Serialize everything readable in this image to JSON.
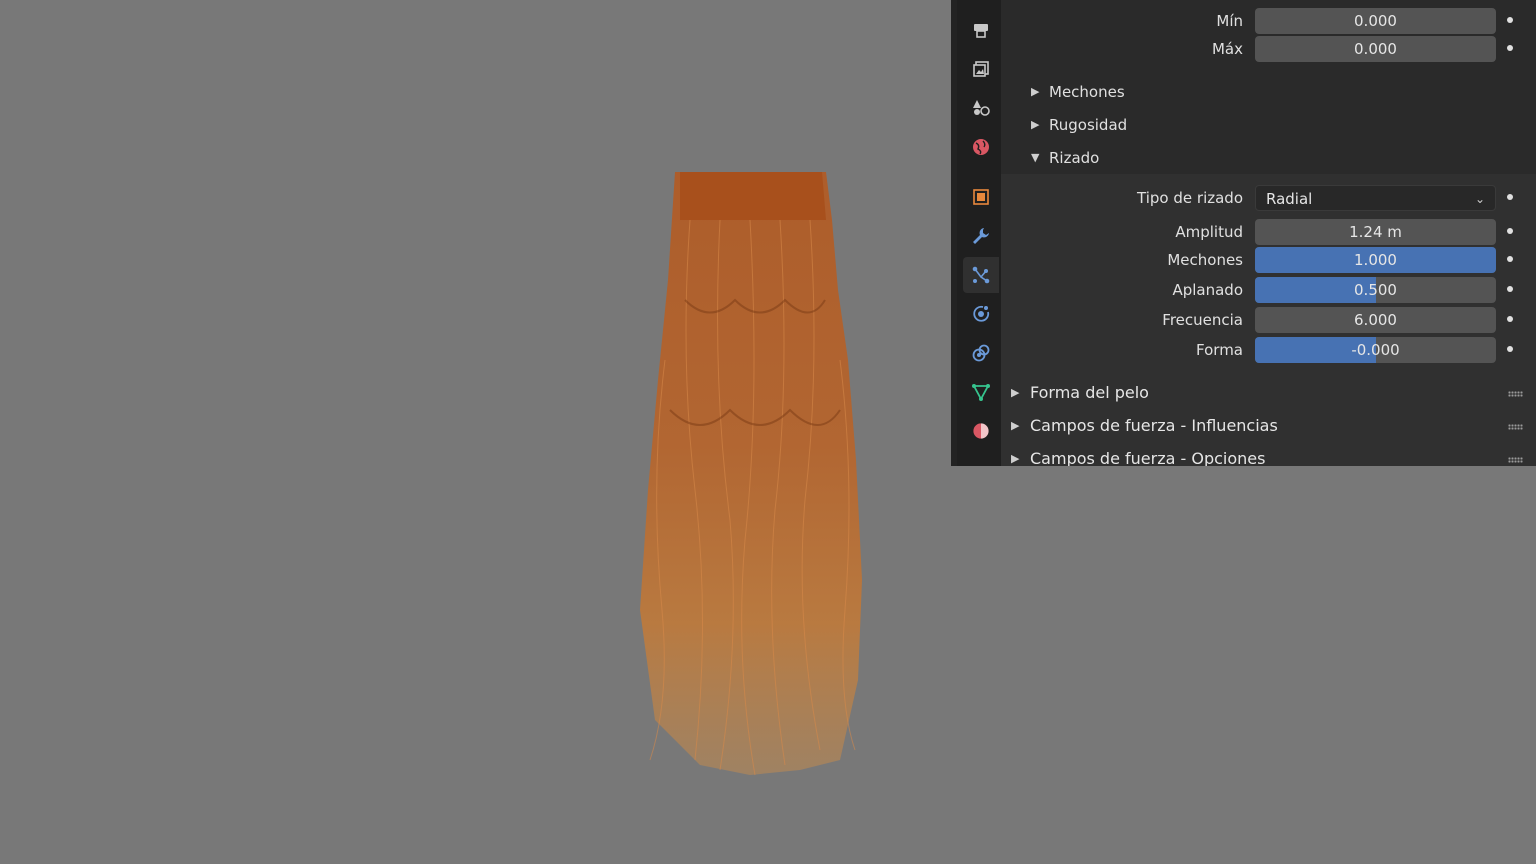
{
  "colors": {
    "viewport_bg": "#787878",
    "panel_bg": "#303030",
    "accent_blue": "#4772b3",
    "field_bg": "#545454",
    "hair": "#b8642a"
  },
  "tabs": [
    {
      "icon": "printer-output-icon",
      "color": "#c8c8c8"
    },
    {
      "icon": "image-view-layer-icon",
      "color": "#c8c8c8"
    },
    {
      "icon": "scene-icon",
      "color": "#c8c8c8"
    },
    {
      "icon": "world-icon",
      "color": "#d95763"
    },
    {
      "icon": "object-icon",
      "color": "#e8883c"
    },
    {
      "icon": "wrench-modifier-icon",
      "color": "#6b9ad9"
    },
    {
      "icon": "particles-icon",
      "color": "#6b9ad9",
      "active": true
    },
    {
      "icon": "physics-icon",
      "color": "#6b9ad9"
    },
    {
      "icon": "constraints-icon",
      "color": "#6b9ad9"
    },
    {
      "icon": "data-mesh-icon",
      "color": "#36c48e"
    },
    {
      "icon": "material-icon",
      "color": "#d95763"
    }
  ],
  "minmax": [
    {
      "label": "Mín",
      "value": "0.000"
    },
    {
      "label": "Máx",
      "value": "0.000"
    }
  ],
  "subpanels": {
    "mechones": "Mechones",
    "rugosidad": "Rugosidad",
    "rizado": "Rizado"
  },
  "rizado": {
    "tipo_label": "Tipo de rizado",
    "tipo_value": "Radial",
    "rows": [
      {
        "label": "Amplitud",
        "value": "1.24 m",
        "fill": 0
      },
      {
        "label": "Mechones",
        "value": "1.000",
        "fill": 1.0
      },
      {
        "label": "Aplanado",
        "value": "0.500",
        "fill": 0.5
      },
      {
        "label": "Frecuencia",
        "value": "6.000",
        "fill": 0
      },
      {
        "label": "Forma",
        "value": "-0.000",
        "fill": 0.5
      }
    ]
  },
  "panels": [
    {
      "label": "Forma del pelo"
    },
    {
      "label": "Campos de fuerza - Influencias"
    },
    {
      "label": "Campos de fuerza - Opciones"
    }
  ]
}
